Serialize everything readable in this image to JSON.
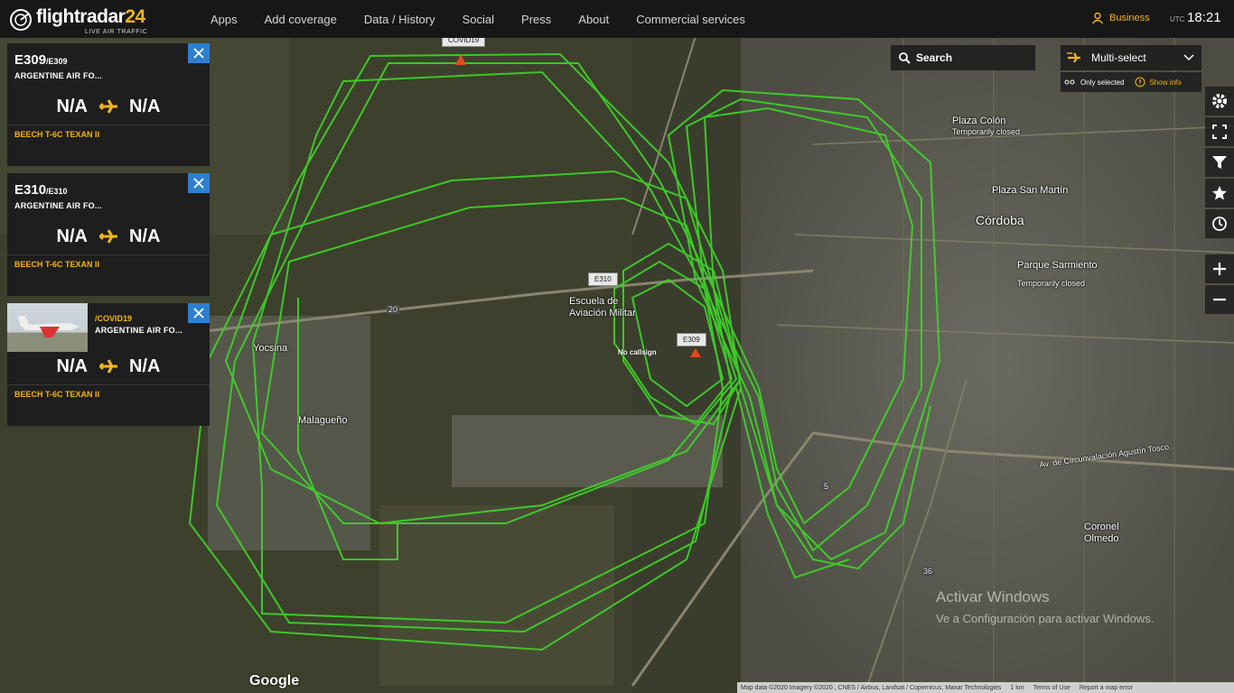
{
  "brand": {
    "name": "flightradar",
    "num": "24",
    "tagline": "LIVE AIR TRAFFIC"
  },
  "nav": [
    {
      "label": "Apps"
    },
    {
      "label": "Add coverage"
    },
    {
      "label": "Data / History"
    },
    {
      "label": "Social"
    },
    {
      "label": "Press"
    },
    {
      "label": "About"
    },
    {
      "label": "Commercial services"
    }
  ],
  "account": {
    "label": "Business"
  },
  "clock": {
    "tz": "UTC",
    "time": "18:21"
  },
  "cards": [
    {
      "callsign": "E309",
      "flight": "/E309",
      "airline": "ARGENTINE AIR FO...",
      "from": "N/A",
      "to": "N/A",
      "aircraft": "BEECH T-6C TEXAN II"
    },
    {
      "callsign": "E310",
      "flight": "/E310",
      "airline": "ARGENTINE AIR FO...",
      "from": "N/A",
      "to": "N/A",
      "aircraft": "BEECH T-6C TEXAN II"
    },
    {
      "callsign": "",
      "flight": "/COVID19",
      "airline": "ARGENTINE AIR FO...",
      "from": "N/A",
      "to": "N/A",
      "aircraft": "BEECH T-6C TEXAN II"
    }
  ],
  "search": {
    "label": "Search"
  },
  "multiselect": {
    "label": "Multi-select",
    "only_selected": "Only selected",
    "show_info": "Show info"
  },
  "map_labels": {
    "cordoba": "Córdoba",
    "plaza_colon": "Plaza Colón",
    "plaza_colon_status": "Temporarily closed",
    "plaza_san_martin": "Plaza San Martín",
    "parque_sarmiento": "Parque Sarmiento",
    "parque_status": "Temporarily closed",
    "escuela": "Escuela de Aviación Militar",
    "malagueno": "Malagueño",
    "yocsina": "Yocsina",
    "coronel_olmedo": "Coronel Olmedo",
    "circunvalacion": "Av. de Circunvalación Agustín Tosco",
    "route20": "20",
    "route36": "36",
    "route5": "5"
  },
  "tags": {
    "covid": "COVID19",
    "e310": "E310",
    "e309": "E309",
    "nocallsign": "No callsign"
  },
  "watermark": {
    "line1": "Activar Windows",
    "line2": "Ve a Configuración para activar Windows."
  },
  "attribution": {
    "data": "Map data ©2020 Imagery ©2020 , CNES / Airbus, Landsat / Copernicus, Maxar Technologies",
    "scale": "1 km",
    "terms": "Terms of Use",
    "report": "Report a map error"
  },
  "google": "Google",
  "colors": {
    "accent": "#f3b41a",
    "close": "#2e7fcf",
    "track": "#3fd62a"
  }
}
